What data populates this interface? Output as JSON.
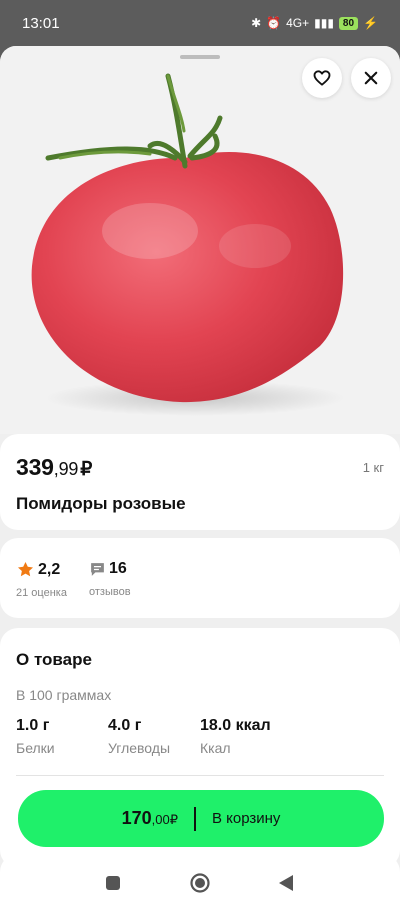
{
  "status": {
    "time": "13:01",
    "network": "4G+",
    "battery": "80"
  },
  "product": {
    "image_icon": "tomato-photo",
    "price_main": "339",
    "price_kop": ",99",
    "currency": "₽",
    "unit": "1 кг",
    "title": "Помидоры розовые"
  },
  "rating": {
    "value": "2,2",
    "count_label": "21 оценка",
    "reviews_value": "16",
    "reviews_label": "отзывов"
  },
  "about": {
    "title": "О товаре",
    "per_label": "В 100 граммах",
    "nutrients": [
      {
        "value": "1.0 г",
        "label": "Белки"
      },
      {
        "value": "4.0 г",
        "label": "Углеводы"
      },
      {
        "value": "18.0 ккал",
        "label": "Ккал"
      }
    ]
  },
  "cart": {
    "price_main": "170",
    "price_kop": ",00",
    "currency": "₽",
    "label": "В корзину"
  },
  "colors": {
    "accent": "#1ff06a",
    "star": "#f07a14"
  }
}
